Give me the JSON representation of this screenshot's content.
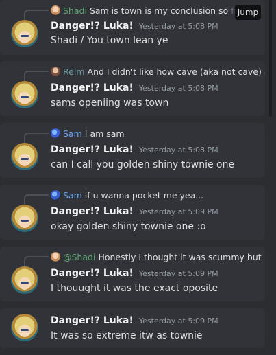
{
  "messages": [
    {
      "reply": {
        "author": "Shadi",
        "text": "Sam is town is my conclusion so far",
        "avatar": "shadi-avatar"
      },
      "author": "Danger!? Luka!",
      "timestamp": "Yesterday at 5:08 PM",
      "content": "Shadi / You town lean ye"
    },
    {
      "reply": {
        "author": "Relm",
        "text": "And I didn't like how cave (aka not cave) a",
        "avatar": "relm-avatar"
      },
      "author": "Danger!? Luka!",
      "timestamp": "Yesterday at 5:08 PM",
      "content": "sams openiing was town"
    },
    {
      "reply": {
        "author": "Sam",
        "text": "I am sam",
        "avatar": "sam-avatar"
      },
      "author": "Danger!? Luka!",
      "timestamp": "Yesterday at 5:08 PM",
      "content": "can I call you golden shiny townie one"
    },
    {
      "reply": {
        "author": "Sam",
        "text": "if u wanna pocket me yea...",
        "avatar": "sam-avatar"
      },
      "author": "Danger!? Luka!",
      "timestamp": "Yesterday at 5:09 PM",
      "content": "okay golden shiny townie one :o"
    },
    {
      "reply": {
        "author": "@Shadi",
        "text": "Honestly I thought it was scummy but",
        "avatar": "shadi-avatar"
      },
      "author": "Danger!? Luka!",
      "timestamp": "Yesterday at 5:09 PM",
      "content": "I thouught it was the exact oposite"
    },
    {
      "author": "Danger!? Luka!",
      "timestamp": "Yesterday at 5:09 PM",
      "content": "It was so extreme itw as townie"
    }
  ],
  "jump_label": "Jump"
}
